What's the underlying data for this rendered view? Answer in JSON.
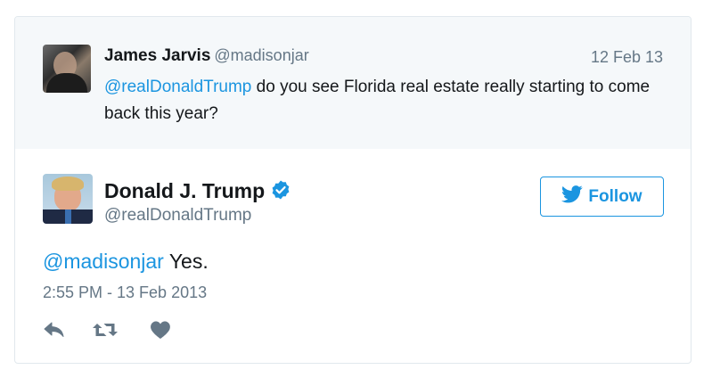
{
  "parent_tweet": {
    "name": "James Jarvis",
    "handle": "@madisonjar",
    "date": "12 Feb 13",
    "mention": "@realDonaldTrump",
    "text": " do you see Florida real estate really starting to come back this year?"
  },
  "main_tweet": {
    "name": "Donald J. Trump",
    "handle": "@realDonaldTrump",
    "follow_label": "Follow",
    "mention": "@madisonjar",
    "text": " Yes.",
    "timestamp": "2:55 PM - 13 Feb 2013"
  },
  "icons": {
    "verified": "verified-badge-icon",
    "follow": "bird-icon",
    "reply": "reply-icon",
    "retweet": "retweet-icon",
    "like": "heart-icon"
  },
  "colors": {
    "accent": "#1b95e0",
    "muted": "#657786",
    "text": "#14171a",
    "parent_bg": "#f5f8fa",
    "border": "#e1e8ed"
  }
}
